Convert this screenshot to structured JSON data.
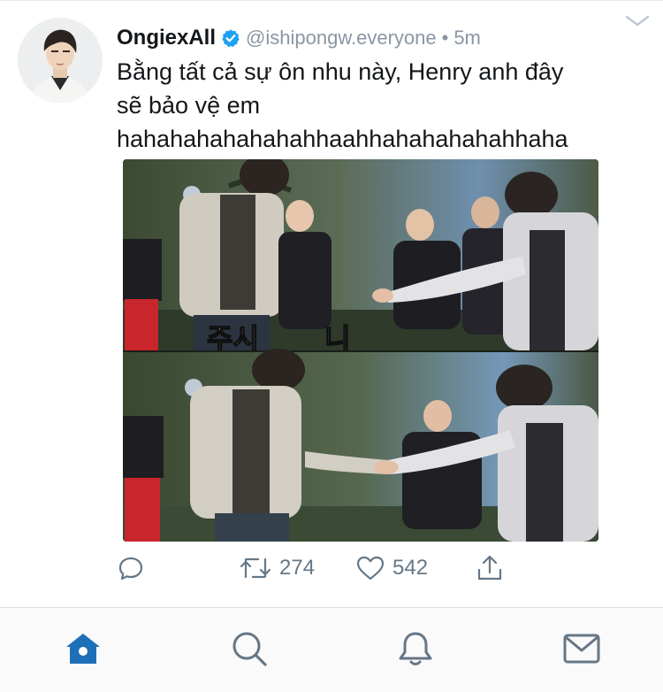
{
  "tweet": {
    "display_name": "OngiexAll",
    "verified": true,
    "handle": "@ishipongw.everyone",
    "separator": "•",
    "time": "5m",
    "text_lines": [
      "Bằng tất cả sự ôn nhu này, Henry anh đây",
      "sẽ bảo vệ em",
      "hahahahahahahahhaahhahahahahahhaha"
    ],
    "media": {
      "caption_fragment_1": "주시",
      "caption_fragment_2": "니"
    }
  },
  "actions": {
    "reply": {
      "icon": "reply-icon",
      "count": ""
    },
    "retweet": {
      "icon": "retweet-icon",
      "count": "274"
    },
    "like": {
      "icon": "heart-icon",
      "count": "542"
    },
    "share": {
      "icon": "share-icon",
      "count": ""
    }
  },
  "tabbar": [
    {
      "icon": "home-icon",
      "active": true
    },
    {
      "icon": "search-icon",
      "active": false
    },
    {
      "icon": "notifications-icon",
      "active": false
    },
    {
      "icon": "messages-icon",
      "active": false
    }
  ],
  "colors": {
    "accent": "#1da1f2",
    "tab_active": "#1d6fb8",
    "tab_inactive": "#657786",
    "muted": "#8a96a3"
  }
}
